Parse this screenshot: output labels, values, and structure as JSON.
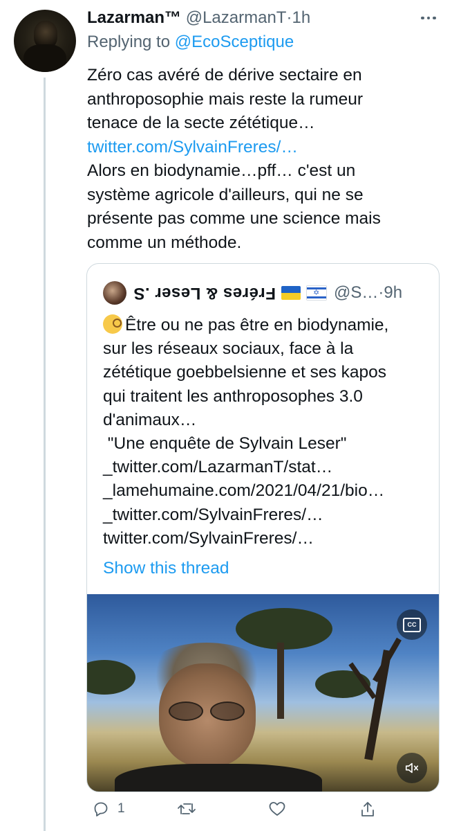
{
  "tweet": {
    "author_name": "Lazarman™",
    "author_handle": "@LazarmanT",
    "separator": "·",
    "time": "1h",
    "replying_prefix": "Replying to",
    "replying_handle": "@EcoSceptique",
    "text_lines": [
      "Zéro cas avéré de dérive sectaire en",
      "anthroposophie mais reste la rumeur",
      "tenace de la secte zététique…",
      "twitter.com/SylvainFreres/…",
      "Alors en biodynamie…pff… c'est un",
      "système agricole d'ailleurs, qui ne se",
      "présente pas comme une science mais",
      "comme un méthode."
    ]
  },
  "quote": {
    "author_name": "Fréres",
    "author_name_amp": "&",
    "author_name_rest": "Leser .S",
    "flag_israel_symbol": "✡",
    "handle": "@S…",
    "separator": "·",
    "time": "9h",
    "text_lines": [
      "Être ou ne pas être en biodynamie,",
      "sur les réseaux sociaux, face à la",
      "zététique goebbelsienne et ses kapos",
      "qui traitent les anthroposophes 3.0",
      "d'animaux…",
      " \"Une enquête de Sylvain Leser\"",
      "_twitter.com/LazarmanT/stat…",
      "_lamehumaine.com/2021/04/21/bio…",
      "_twitter.com/SylvainFreres/…",
      "twitter.com/SylvainFreres/…"
    ],
    "show_thread": "Show this thread",
    "cc_label": "CC"
  },
  "actions": {
    "reply_count": "1"
  },
  "icons": {
    "more": "more-icon",
    "reply": "reply-icon",
    "retweet": "retweet-icon",
    "like": "heart-icon",
    "share": "share-icon",
    "captions": "captions-icon",
    "mute": "mute-icon",
    "emoji": "monocle-face-emoji"
  },
  "colors": {
    "link": "#1d9bf0",
    "muted": "#536471",
    "text": "#0f1419",
    "border": "#cfd9de"
  }
}
